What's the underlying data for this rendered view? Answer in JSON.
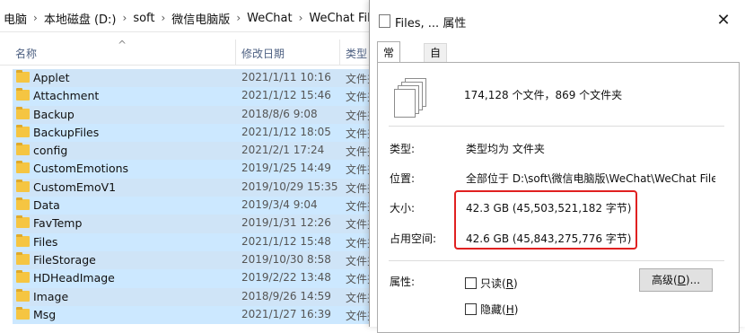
{
  "explorer": {
    "breadcrumb": [
      "电脑",
      "本地磁盘 (D:)",
      "soft",
      "微信电脑版",
      "WeChat",
      "WeChat Files"
    ],
    "breadcrumb_sep": "›",
    "columns": {
      "name": "名称",
      "date": "修改日期",
      "type": "类型"
    },
    "sort_caret": "^",
    "files": [
      {
        "name": "Applet",
        "date": "2021/1/11 10:16",
        "type": "文件夹"
      },
      {
        "name": "Attachment",
        "date": "2021/1/12 15:46",
        "type": "文件夹"
      },
      {
        "name": "Backup",
        "date": "2018/8/6 9:08",
        "type": "文件夹"
      },
      {
        "name": "BackupFiles",
        "date": "2021/1/12 18:05",
        "type": "文件夹"
      },
      {
        "name": "config",
        "date": "2021/2/1 17:24",
        "type": "文件夹"
      },
      {
        "name": "CustomEmotions",
        "date": "2019/1/25 14:49",
        "type": "文件夹"
      },
      {
        "name": "CustomEmoV1",
        "date": "2019/10/29 15:35",
        "type": "文件夹"
      },
      {
        "name": "Data",
        "date": "2019/3/4 9:04",
        "type": "文件夹"
      },
      {
        "name": "FavTemp",
        "date": "2019/1/31 12:26",
        "type": "文件夹"
      },
      {
        "name": "Files",
        "date": "2021/1/12 15:48",
        "type": "文件夹"
      },
      {
        "name": "FileStorage",
        "date": "2019/10/30 8:58",
        "type": "文件夹"
      },
      {
        "name": "HDHeadImage",
        "date": "2019/2/22 13:48",
        "type": "文件夹"
      },
      {
        "name": "Image",
        "date": "2018/9/26 14:59",
        "type": "文件夹"
      },
      {
        "name": "Msg",
        "date": "2021/1/27 16:39",
        "type": "文件夹"
      }
    ]
  },
  "dialog": {
    "title": "Files, ... 属性",
    "close": "✕",
    "tabs": {
      "general": "常规",
      "custom": "自定义"
    },
    "summary": "174,128 个文件，869 个文件夹",
    "type_label": "类型:",
    "type_value": "类型均为 文件夹",
    "location_label": "位置:",
    "location_value": "全部位于 D:\\soft\\微信电脑版\\WeChat\\WeChat Files\\",
    "size_label": "大小:",
    "size_value": "42.3 GB (45,503,521,182 字节)",
    "disk_size_label": "占用空间:",
    "disk_size_value": "42.6 GB (45,843,275,776 字节)",
    "attributes_label": "属性:",
    "readonly_prefix": "只读(",
    "readonly_key": "R",
    "readonly_suffix": ")",
    "hidden_prefix": "隐藏(",
    "hidden_key": "H",
    "hidden_suffix": ")",
    "advanced_prefix": "高级(",
    "advanced_key": "D",
    "advanced_suffix": ")..."
  },
  "colors": {
    "selection": "#cce8ff",
    "highlight_box": "#e02020",
    "folder": "#f5c542"
  }
}
